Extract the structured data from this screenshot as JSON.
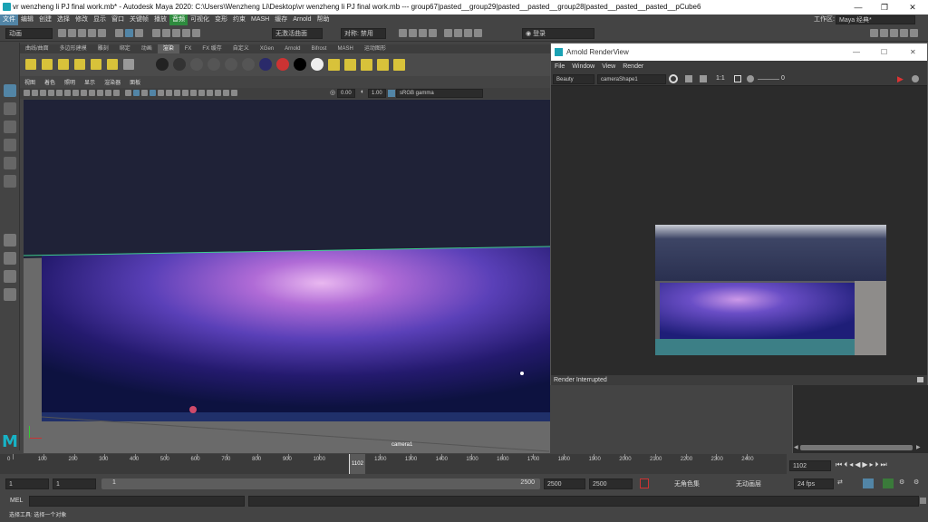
{
  "window": {
    "title": "vr wenzheng li PJ final work.mb* - Autodesk Maya 2020: C:\\Users\\Wenzheng Li\\Desktop\\vr wenzheng li PJ final work.mb   ---   group67|pasted__group29|pasted__pasted__group28|pasted__pasted__pasted__pCube6",
    "minimize": "—",
    "maximize": "❐",
    "close": "✕"
  },
  "menubar": {
    "items": [
      "文件",
      "编辑",
      "创建",
      "选择",
      "修改",
      "显示",
      "窗口",
      "关键帧",
      "播放",
      "音频",
      "可视化",
      "变形",
      "约束",
      "MASH",
      "缓存",
      "Arnold",
      "帮助"
    ],
    "active_index": 0,
    "active_extra_index": 9,
    "workspace_label": "工作区:",
    "workspace_value": "Maya 经典*"
  },
  "statusline": {
    "mode": "动画",
    "live_surface": "无激活曲面",
    "symmetry": "对称: 禁用",
    "login": "登录"
  },
  "shelf": {
    "tabs": [
      "曲线/曲面",
      "多边形建模",
      "雕刻",
      "绑定",
      "动画",
      "渲染",
      "FX",
      "FX 缓存",
      "自定义",
      "XGen",
      "Arnold",
      "Bifrost",
      "MASH",
      "运动图形"
    ],
    "active_index": 5
  },
  "viewport": {
    "menu": [
      "视图",
      "着色",
      "照明",
      "显示",
      "渲染器",
      "面板"
    ],
    "field1": "0.00",
    "field2": "1.00",
    "colorspace": "sRGB gamma",
    "camera_label": "camera1",
    "logo": "M"
  },
  "arnold": {
    "title": "Arnold RenderView",
    "menu": [
      "File",
      "Window",
      "View",
      "Render"
    ],
    "aov": "Beauty",
    "camera": "cameraShape1",
    "ratio": "1:1",
    "exposure": "0",
    "status": "Render Interrupted"
  },
  "timeline": {
    "ticks": [
      "0",
      "100",
      "200",
      "300",
      "400",
      "500",
      "600",
      "700",
      "800",
      "900",
      "1000",
      "1102",
      "1200",
      "1300",
      "1400",
      "1500",
      "1600",
      "1700",
      "1800",
      "1900",
      "2000",
      "2100",
      "2200",
      "2300",
      "2400"
    ],
    "current_frame": "1102",
    "current_field": "1102"
  },
  "range": {
    "start": "1",
    "start2": "1",
    "slider_start": "1",
    "slider_end": "2500",
    "end": "2500",
    "end2": "2500",
    "char_set": "无角色集",
    "anim_layer": "无动画层",
    "fps": "24 fps"
  },
  "mel": {
    "label": "MEL"
  },
  "help": {
    "text": "选择工具: 选择一个对象"
  },
  "colors": {
    "accent": "#5285a6",
    "titlebar": "#ffffff",
    "panel": "#444444"
  }
}
